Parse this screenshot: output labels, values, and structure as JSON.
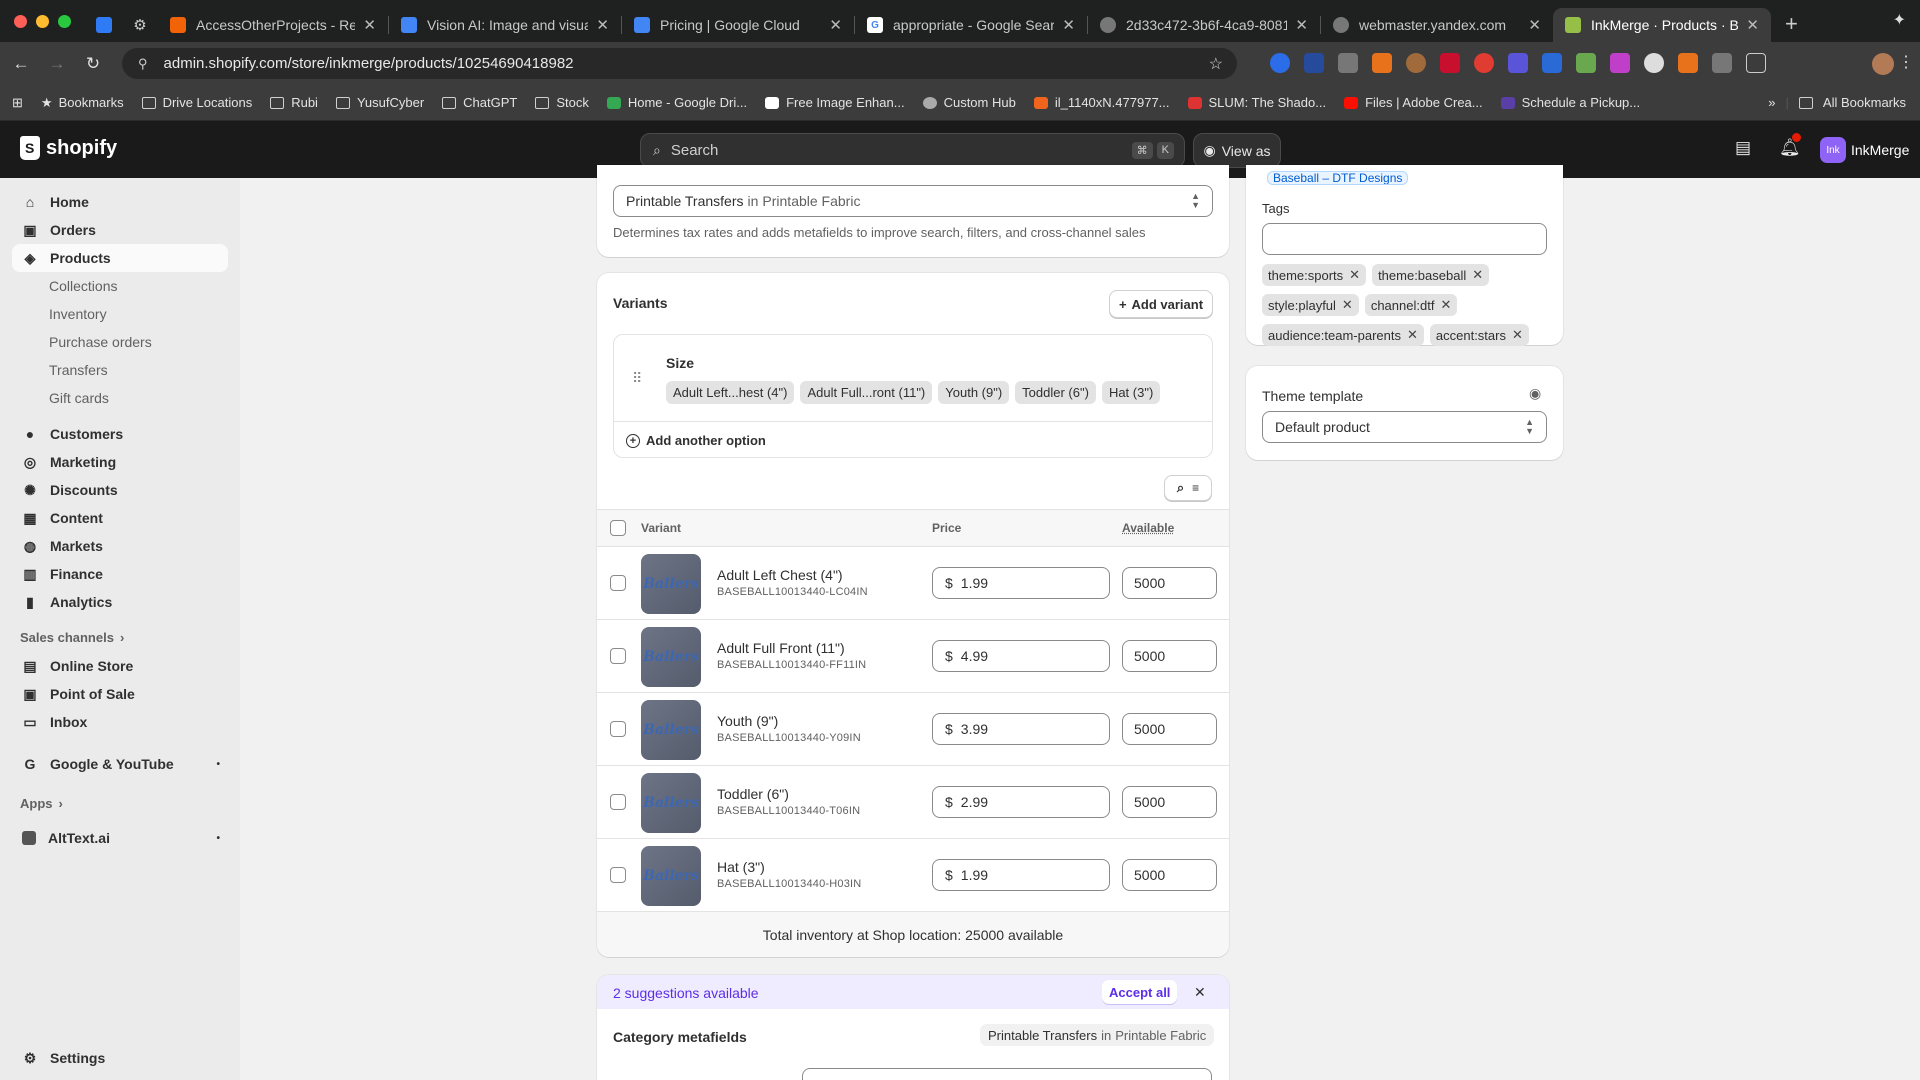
{
  "browser": {
    "tabs": [
      {
        "title": "AccessOtherProjects - Repl",
        "color": "#f26207"
      },
      {
        "title": "Vision AI: Image and visual A",
        "color": "#4285f4"
      },
      {
        "title": "Pricing | Google Cloud",
        "color": "#4285f4"
      },
      {
        "title": "appropriate - Google Search",
        "color": "#ffffff"
      },
      {
        "title": "2d33c472-3b6f-4ca9-8081",
        "color": "#9e9e9e"
      },
      {
        "title": "webmaster.yandex.com",
        "color": "#9e9e9e"
      },
      {
        "title": "InkMerge · Products · Busy",
        "color": "#95bf47"
      }
    ],
    "url": "admin.shopify.com/store/inkmerge/products/10254690418982",
    "bookmarks": [
      {
        "label": "Bookmarks",
        "icon": "star-icon"
      },
      {
        "label": "Drive Locations",
        "icon": "folder-icon"
      },
      {
        "label": "Rubi",
        "icon": "folder-icon"
      },
      {
        "label": "YusufCyber",
        "icon": "folder-icon"
      },
      {
        "label": "ChatGPT",
        "icon": "folder-icon"
      },
      {
        "label": "Stock",
        "icon": "folder-icon"
      },
      {
        "label": "Home - Google Dri...",
        "icon": "drive-icon"
      },
      {
        "label": "Free Image Enhan...",
        "icon": "c-icon"
      },
      {
        "label": "Custom Hub",
        "icon": "gear-icon"
      },
      {
        "label": "il_1140xN.477977...",
        "icon": "etsy-icon"
      },
      {
        "label": "SLUM: The Shado...",
        "icon": "shop-icon"
      },
      {
        "label": "Files | Adobe Crea...",
        "icon": "adobe-icon"
      },
      {
        "label": "Schedule a Pickup...",
        "icon": "ups-icon"
      }
    ],
    "all_bookmarks": "All Bookmarks"
  },
  "shopify": {
    "logo": "shopify",
    "search_placeholder": "Search",
    "kbd1": "⌘",
    "kbd2": "K",
    "view_as": "View as",
    "notif_count": "1",
    "store_initials": "Ink",
    "store_name": "InkMerge"
  },
  "sidebar": {
    "main": [
      {
        "label": "Home",
        "icon": "home-icon"
      },
      {
        "label": "Orders",
        "icon": "orders-icon"
      },
      {
        "label": "Products",
        "icon": "tag-icon"
      }
    ],
    "product_sub": [
      "Collections",
      "Inventory",
      "Purchase orders",
      "Transfers",
      "Gift cards"
    ],
    "secondary": [
      {
        "label": "Customers",
        "icon": "person-icon"
      },
      {
        "label": "Marketing",
        "icon": "target-icon"
      },
      {
        "label": "Discounts",
        "icon": "discount-icon"
      },
      {
        "label": "Content",
        "icon": "content-icon"
      },
      {
        "label": "Markets",
        "icon": "globe-icon"
      },
      {
        "label": "Finance",
        "icon": "bank-icon"
      },
      {
        "label": "Analytics",
        "icon": "chart-icon"
      }
    ],
    "sales_channels_label": "Sales channels",
    "channels": [
      {
        "label": "Online Store",
        "icon": "store-icon"
      },
      {
        "label": "Point of Sale",
        "icon": "pos-icon"
      },
      {
        "label": "Inbox",
        "icon": "inbox-icon"
      }
    ],
    "google": "Google & YouTube",
    "apps_label": "Apps",
    "alttext": "AltText.ai",
    "settings": "Settings"
  },
  "category": {
    "value_main": "Printable Transfers",
    "value_in": "in",
    "value_parent": "Printable Fabric",
    "help": "Determines tax rates and adds metafields to improve search, filters, and cross-channel sales"
  },
  "variants": {
    "title": "Variants",
    "add_variant": "Add variant",
    "option_name": "Size",
    "option_values": [
      "Adult Left...hest (4\")",
      "Adult Full...ront (11\")",
      "Youth (9\")",
      "Toddler (6\")",
      "Hat (3\")"
    ],
    "add_option": "Add another option",
    "col_variant": "Variant",
    "col_price": "Price",
    "col_available": "Available",
    "currency": "$",
    "rows": [
      {
        "name": "Adult Left Chest (4\")",
        "sku": "BASEBALL10013440-LC04IN",
        "price": "1.99",
        "available": "5000"
      },
      {
        "name": "Adult Full Front (11\")",
        "sku": "BASEBALL10013440-FF11IN",
        "price": "4.99",
        "available": "5000"
      },
      {
        "name": "Youth (9\")",
        "sku": "BASEBALL10013440-Y09IN",
        "price": "3.99",
        "available": "5000"
      },
      {
        "name": "Toddler (6\")",
        "sku": "BASEBALL10013440-T06IN",
        "price": "2.99",
        "available": "5000"
      },
      {
        "name": "Hat (3\")",
        "sku": "BASEBALL10013440-H03IN",
        "price": "1.99",
        "available": "5000"
      }
    ],
    "thumb_text": "Ballers",
    "total": "Total inventory at Shop location: 25000 available"
  },
  "suggestions": {
    "text": "2 suggestions available",
    "accept_all": "Accept all"
  },
  "metafields": {
    "title": "Category metafields",
    "badge_main": "Printable Transfers",
    "badge_in": "in",
    "badge_parent": "Printable Fabric"
  },
  "right": {
    "collection_chip": "Baseball – DTF Designs",
    "tags_label": "Tags",
    "tags": [
      "theme:sports",
      "theme:baseball",
      "style:playful",
      "channel:dtf",
      "audience:team-parents",
      "accent:stars"
    ],
    "theme_label": "Theme template",
    "theme_value": "Default product"
  }
}
